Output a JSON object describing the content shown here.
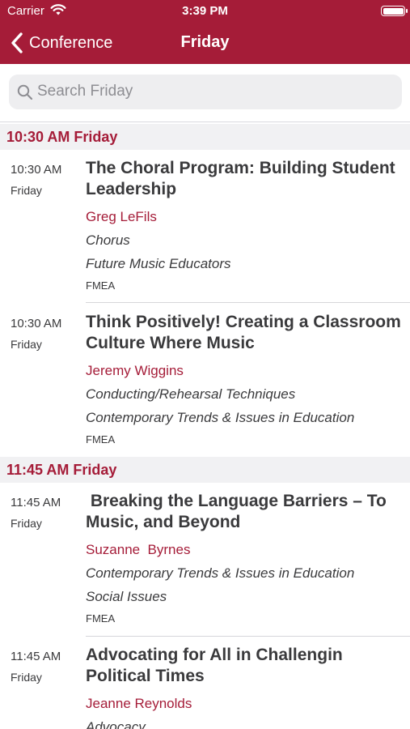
{
  "status_bar": {
    "carrier": "Carrier",
    "time": "3:39 PM"
  },
  "nav": {
    "back_label": "Conference",
    "title": "Friday"
  },
  "search": {
    "placeholder": "Search Friday"
  },
  "sections": [
    {
      "header": "10:30 AM  Friday",
      "sessions": [
        {
          "time": "10:30 AM",
          "day": "Friday",
          "title": "The Choral Program: Building Student Leadership",
          "speaker": "Greg LeFils",
          "topics": [
            "Chorus",
            "Future Music Educators"
          ],
          "org": "FMEA"
        },
        {
          "time": "10:30 AM",
          "day": "Friday",
          "title": "Think Positively! Creating a Classroom Culture Where Music",
          "speaker": "Jeremy Wiggins",
          "topics": [
            "Conducting/Rehearsal Techniques",
            "Contemporary Trends & Issues in Education"
          ],
          "org": "FMEA"
        }
      ]
    },
    {
      "header": "11:45 AM  Friday",
      "sessions": [
        {
          "time": "11:45 AM",
          "day": "Friday",
          "title": " Breaking the Language Barriers – To Music, and Beyond",
          "speaker": "Suzanne  Byrnes",
          "topics": [
            "Contemporary Trends & Issues in Education",
            "Social Issues"
          ],
          "org": "FMEA"
        },
        {
          "time": "11:45 AM",
          "day": "Friday",
          "title": "Advocating for All in Challengin Political Times",
          "speaker": "Jeanne Reynolds",
          "topics": [
            "Advocacy"
          ],
          "org": ""
        }
      ]
    }
  ],
  "icons": {
    "back": "chevron-left-icon",
    "search": "search-icon",
    "wifi": "wifi-icon",
    "battery": "battery-icon"
  },
  "colors": {
    "accent": "#a51c38",
    "section_bg": "#f1f1f3",
    "search_bg": "#eeeef0"
  }
}
